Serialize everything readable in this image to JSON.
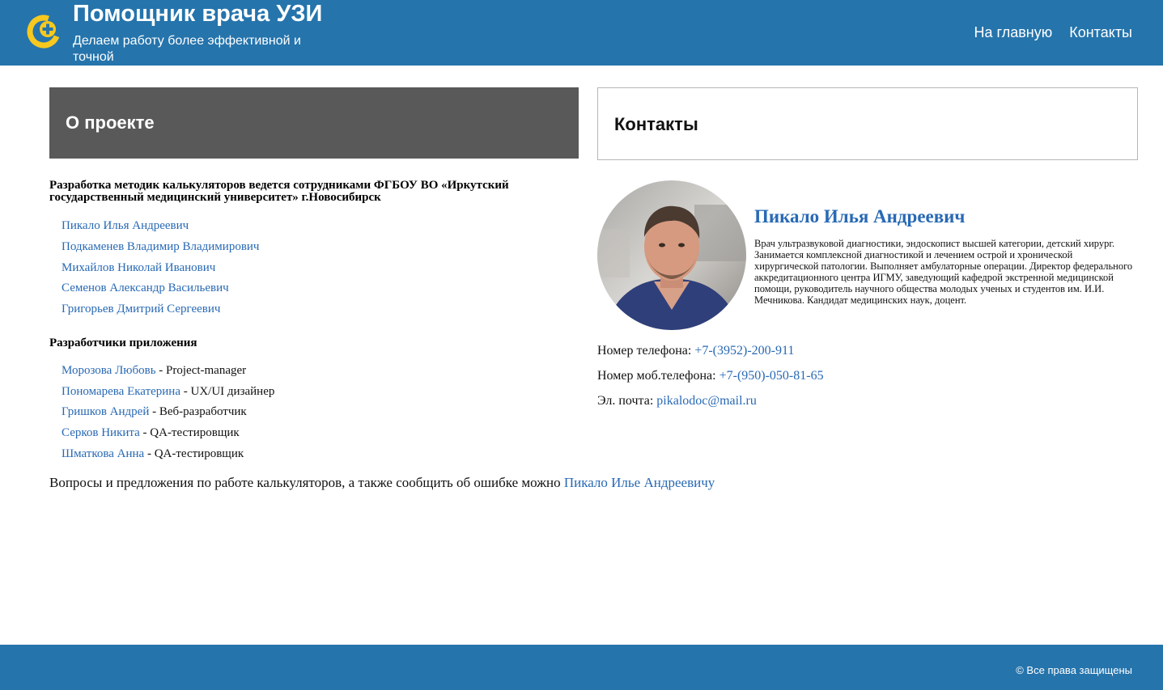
{
  "header": {
    "title": "Помощник врача УЗИ",
    "subtitle": "Делаем работу более эффективной и точной",
    "nav": [
      "На главную",
      "Контакты"
    ]
  },
  "about": {
    "title": "О проекте",
    "org_text": "Разработка методик калькуляторов ведется сотрудниками ФГБОУ ВО «Иркутский государственный медицинский университет» г.Новосибирск",
    "staff": [
      "Пикало Илья Андреевич",
      "Подкаменев Владимир Владимирович",
      "Михайлов Николай Иванович",
      "Семенов Александр Васильевич",
      "Григорьев Дмитрий Сергеевич"
    ],
    "developers_heading": "Разработчики приложения",
    "developers": [
      {
        "name": "Морозова Любовь",
        "role": " - Project-manager"
      },
      {
        "name": "Пономарева Екатерина",
        "role": " - UX/UI дизайнер"
      },
      {
        "name": "Гришков Андрей",
        "role": " - Веб-разработчик"
      },
      {
        "name": "Серков Никита",
        "role": " - QA-тестировщик"
      },
      {
        "name": "Шматкова Анна",
        "role": " - QA-тестировщик"
      }
    ],
    "questions_text": "Вопросы и предложения по работе калькуляторов, а также сообщить об ошибке можно ",
    "questions_link": "Пикало Илье Андреевичу"
  },
  "contacts": {
    "title": "Контакты",
    "doctor_name": "Пикало Илья Андреевич",
    "doctor_description": "Врач ультразвуковой диагностики, эндоскопист высшей категории, детский хирург. Занимается комплексной диагностикой и лечением острой и хронической хирургической патологии. Выполняет амбулаторные операции. Директор федерального аккредитационного центра ИГМУ, заведующий кафедрой экстренной медицинской помощи, руководитель научного общества молодых ученых и студентов им. И.И. Мечникова. Кандидат медицинских наук, доцент.",
    "phone_label": "Номер телефона: ",
    "phone": "+7-(3952)-200-911",
    "mobile_label": "Номер моб.телефона: ",
    "mobile": "+7-(950)-050-81-65",
    "email_label": "Эл. почта: ",
    "email": "pikalodoc@mail.ru"
  },
  "footer": {
    "copyright": "© Все права защищены"
  },
  "colors": {
    "brand_blue": "#2574ac",
    "link_blue": "#2869b4",
    "about_bg": "#595959",
    "logo_yellow": "#f7c81e"
  },
  "icons": {
    "logo": "medical-cross-logo-icon"
  }
}
